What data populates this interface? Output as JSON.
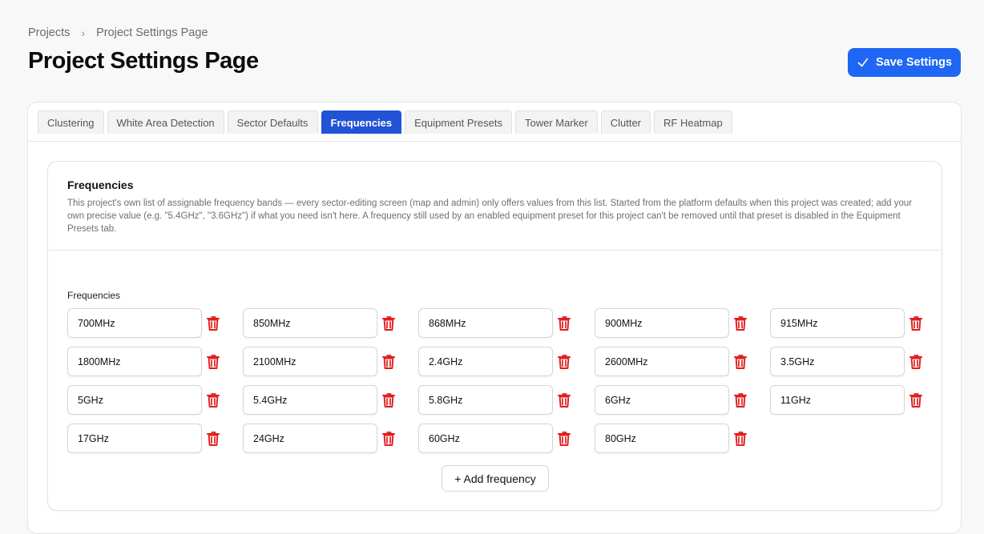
{
  "breadcrumb": {
    "root": "Projects",
    "separator": "›",
    "current": "Project Settings Page"
  },
  "page_title": "Project Settings Page",
  "save_button": {
    "label": "Save Settings",
    "icon": "check-icon",
    "color": "#1f66f4"
  },
  "tabs": [
    {
      "label": "Clustering",
      "active": false
    },
    {
      "label": "White Area Detection",
      "active": false
    },
    {
      "label": "Sector Defaults",
      "active": false
    },
    {
      "label": "Frequencies",
      "active": true
    },
    {
      "label": "Equipment Presets",
      "active": false
    },
    {
      "label": "Tower Marker",
      "active": false
    },
    {
      "label": "Clutter",
      "active": false
    },
    {
      "label": "RF Heatmap",
      "active": false
    }
  ],
  "section": {
    "title": "Frequencies",
    "description": "This project's own list of assignable frequency bands — every sector-editing screen (map and admin) only offers values from this list. Started from the platform defaults when this project was created; add your own precise value (e.g. \"5.4GHz\", \"3.6GHz\") if what you need isn't here. A frequency still used by an enabled equipment preset for this project can't be removed until that preset is disabled in the Equipment Presets tab.",
    "list_label": "Frequencies",
    "frequencies": [
      "700MHz",
      "850MHz",
      "868MHz",
      "900MHz",
      "915MHz",
      "1800MHz",
      "2100MHz",
      "2.4GHz",
      "2600MHz",
      "3.5GHz",
      "5GHz",
      "5.4GHz",
      "5.8GHz",
      "6GHz",
      "11GHz",
      "17GHz",
      "24GHz",
      "60GHz",
      "80GHz"
    ],
    "delete_icon": "trash-icon",
    "delete_color": "#e11d1d",
    "add_button": "+ Add frequency"
  }
}
